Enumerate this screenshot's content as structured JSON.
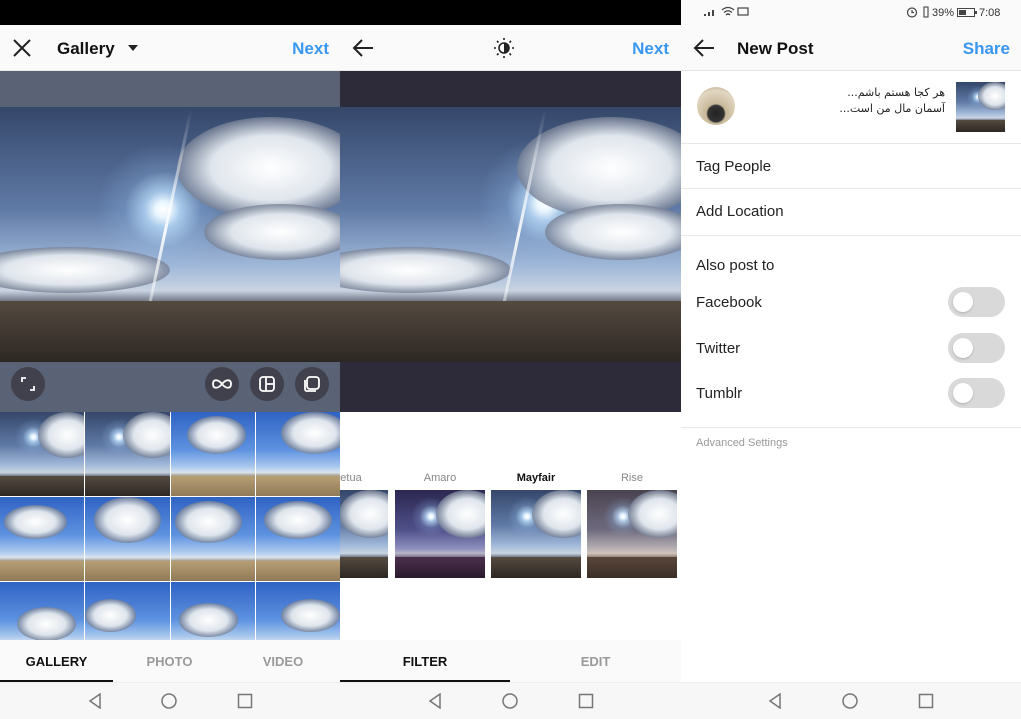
{
  "gallery": {
    "title": "Gallery",
    "next_label": "Next",
    "tabs": [
      {
        "label": "GALLERY",
        "active": true
      },
      {
        "label": "PHOTO",
        "active": false
      },
      {
        "label": "VIDEO",
        "active": false
      }
    ],
    "controls": [
      "expand-icon",
      "boomerang-icon",
      "layout-icon",
      "multi-select-icon"
    ]
  },
  "filter": {
    "next_label": "Next",
    "filters": [
      {
        "label": "etua",
        "active": false,
        "tone": "default"
      },
      {
        "label": "Amaro",
        "active": false,
        "tone": "purple"
      },
      {
        "label": "Mayfair",
        "active": true,
        "tone": "default"
      },
      {
        "label": "Rise",
        "active": false,
        "tone": "warm"
      }
    ],
    "tabs": [
      {
        "label": "FILTER",
        "active": true
      },
      {
        "label": "EDIT",
        "active": false
      }
    ]
  },
  "new_post": {
    "status": {
      "battery": "39%",
      "time": "7:08"
    },
    "title": "New Post",
    "share_label": "Share",
    "caption_line1": "هر کجا هستم باشم...",
    "caption_line2": "آسمان مال من است...",
    "tag_people": "Tag People",
    "add_location": "Add Location",
    "also_post_to": "Also post to",
    "networks": [
      {
        "label": "Facebook",
        "enabled": false
      },
      {
        "label": "Twitter",
        "enabled": false
      },
      {
        "label": "Tumblr",
        "enabled": false
      }
    ],
    "advanced_settings": "Advanced Settings"
  },
  "colors": {
    "accent": "#3897f0",
    "text": "#111111",
    "muted": "#9a9a9a",
    "toggle_off": "#d9d9d9"
  }
}
